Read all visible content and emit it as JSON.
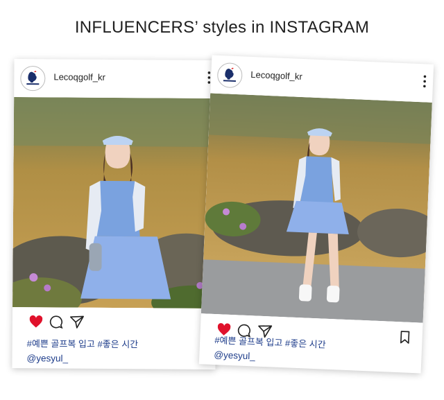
{
  "headline": "INFLUENCERS’ styles in INSTAGRAM",
  "posts": [
    {
      "account": "Lecoqgolf_kr",
      "avatar_text": "le coq sportif",
      "hashtags": "#예쁜 골프복 입고 #좋은 시간",
      "mention": "@yesyul_",
      "liked": true,
      "show_bookmark": false
    },
    {
      "account": "Lecoqgolf_kr",
      "avatar_text": "le coq sportif",
      "hashtags": "#예쁜 골프복 입고 #좋은 시간",
      "mention": "@yesyul_",
      "liked": true,
      "show_bookmark": true
    }
  ],
  "colors": {
    "heart": "#e0112b",
    "caption": "#1d3c8a",
    "brand_navy": "#1b2f6b"
  }
}
